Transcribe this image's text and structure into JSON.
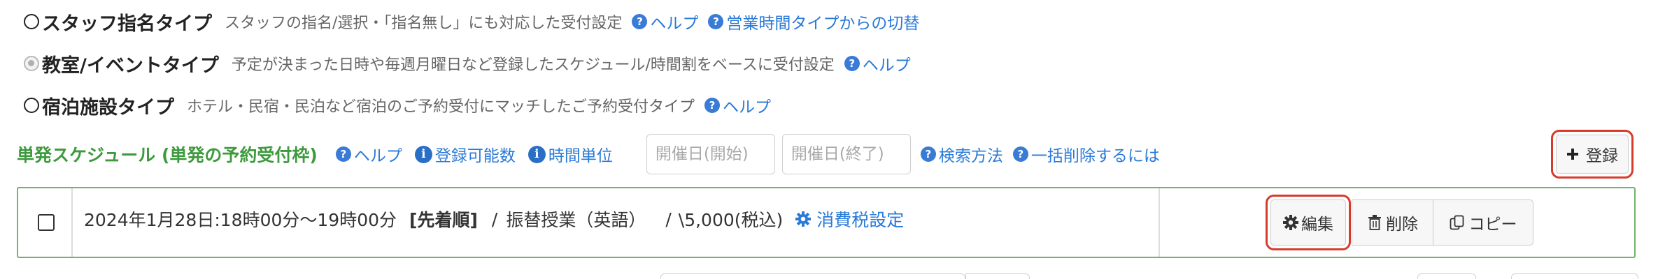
{
  "booking_types": {
    "staff": {
      "title": "スタッフ指名タイプ",
      "description": "スタッフの指名/選択・「指名無し」にも対応した受付設定",
      "help_label": "ヘルプ",
      "switch_label": "営業時間タイプからの切替"
    },
    "class_event": {
      "title": "教室/イベントタイプ",
      "description": "予定が決まった日時や毎週月曜日など登録したスケジュール/時間割をベースに受付設定",
      "help_label": "ヘルプ"
    },
    "lodging": {
      "title": "宿泊施設タイプ",
      "description": "ホテル・民宿・民泊など宿泊のご予約受付にマッチしたご予約受付タイプ",
      "help_label": "ヘルプ"
    }
  },
  "single_schedule": {
    "title": "単発スケジュール (単発の予約受付枠)",
    "help_label": "ヘルプ",
    "capacity_label": "登録可能数",
    "time_unit_label": "時間単位",
    "start_placeholder": "開催日(開始)",
    "end_placeholder": "開催日(終了)",
    "search_method_label": "検索方法",
    "bulk_delete_label": "一括削除するには",
    "register_label": "登録"
  },
  "schedule_entry": {
    "datetime": "2024年1月28日:18時00分〜19時00分",
    "order": "[先着順]",
    "separator1": "/",
    "name": "振替授業（英語）",
    "separator2": "/",
    "price": "\\5,000(税込)",
    "tax_label": "消費税設定",
    "edit_label": "編集",
    "delete_label": "削除",
    "copy_label": "コピー"
  },
  "colors": {
    "link": "#2a7ad8",
    "section_title": "#3e9a3e",
    "highlight": "#d63c2c",
    "schedule_border": "#6fb46f"
  }
}
